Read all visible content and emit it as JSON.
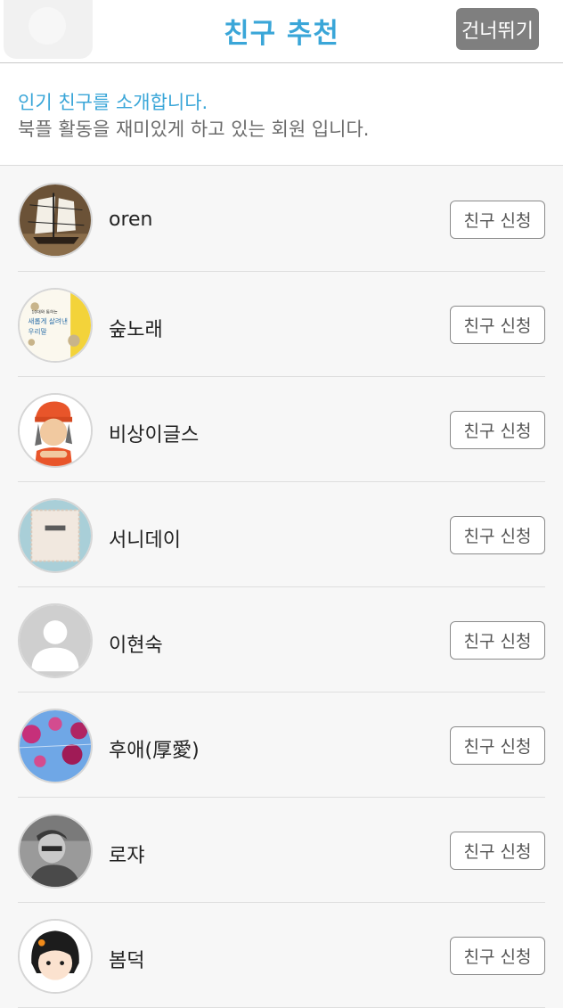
{
  "header": {
    "title": "친구 추천",
    "skip_label": "건너뛰기"
  },
  "intro": {
    "line1": "인기 친구를 소개합니다.",
    "line2": "북플 활동을 재미있게 하고 있는 회원 입니다."
  },
  "users": [
    {
      "name": "oren",
      "avatar_icon": "ship-icon",
      "button": "친구 신청"
    },
    {
      "name": "숲노래",
      "avatar_icon": "book-cover-icon",
      "avatar_text": [
        "10대와 통하는",
        "새롭게 살려낸",
        "우리말"
      ],
      "button": "친구 신청"
    },
    {
      "name": "비상이글스",
      "avatar_icon": "cartoon-person-icon",
      "button": "친구 신청"
    },
    {
      "name": "서니데이",
      "avatar_icon": "fabric-pouch-icon",
      "button": "친구 신청"
    },
    {
      "name": "이현숙",
      "avatar_icon": "default-user-icon",
      "button": "친구 신청"
    },
    {
      "name": "후애(厚愛)",
      "avatar_icon": "pink-circles-icon",
      "button": "친구 신청"
    },
    {
      "name": "로쟈",
      "avatar_icon": "photo-person-icon",
      "button": "친구 신청"
    },
    {
      "name": "봄덕",
      "avatar_icon": "cartoon-girl-icon",
      "button": "친구 신청"
    }
  ],
  "colors": {
    "accent": "#3aa6d8",
    "skip_bg": "#7f7f7f",
    "background": "#f7f7f7"
  }
}
